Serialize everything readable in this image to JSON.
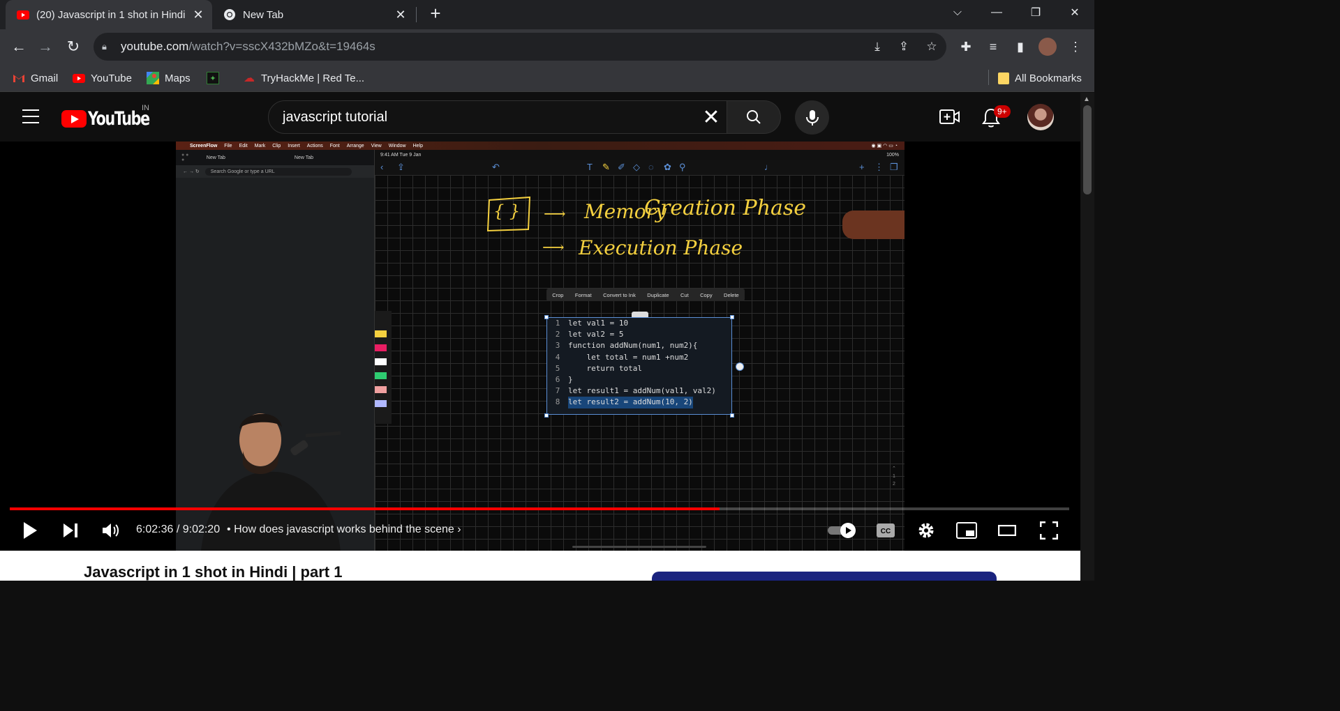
{
  "browser": {
    "tabs": [
      {
        "title": "(20) Javascript in 1 shot in Hindi",
        "active": true,
        "icon": "youtube-icon"
      },
      {
        "title": "New Tab",
        "active": false,
        "icon": "chrome-icon"
      }
    ],
    "url": {
      "host": "youtube.com",
      "path": "/watch?v=sscX432bMZo&t=19464s"
    },
    "bookmarks": [
      {
        "label": "Gmail",
        "icon": "gmail-icon"
      },
      {
        "label": "YouTube",
        "icon": "youtube-icon"
      },
      {
        "label": "Maps",
        "icon": "maps-icon"
      },
      {
        "label": "",
        "icon": "extension-bookmark-icon"
      },
      {
        "label": "TryHackMe | Red Te...",
        "icon": "tryhackme-icon"
      }
    ],
    "all_bookmarks": "All Bookmarks"
  },
  "youtube": {
    "logo_text": "YouTube",
    "country": "IN",
    "search_query": "javascript tutorial",
    "notifications": "9+"
  },
  "video": {
    "time": "6:02:36 / 9:02:20",
    "separator": "•",
    "chapter": "How does javascript works behind the scene",
    "progress_fraction": 0.67,
    "title": "Javascript in 1 shot in Hindi | part 1"
  },
  "frame": {
    "mac_menu": [
      "ScreenFlow",
      "File",
      "Edit",
      "Mark",
      "Clip",
      "Insert",
      "Actions",
      "Font",
      "Arrange",
      "View",
      "Window",
      "Help"
    ],
    "mini_chrome": {
      "tab1": "New Tab",
      "tab2": "New Tab",
      "omnibox": "Search Google or type a URL"
    },
    "ipad_status_left": "9:41 AM  Tue 9 Jan",
    "ipad_status_right": "100%",
    "notes": {
      "braces": "{ }",
      "arrow": "⟶",
      "memory": "Memory",
      "creation": "Creation Phase",
      "execution": "Execution Phase"
    },
    "selection_menu": [
      "Crop",
      "Format",
      "Convert to Ink",
      "Duplicate",
      "Cut",
      "Copy",
      "Delete"
    ],
    "code": [
      {
        "n": "1",
        "text": "let val1 = 10"
      },
      {
        "n": "2",
        "text": "let val2 = 5"
      },
      {
        "n": "3",
        "text": "function addNum(num1, num2){"
      },
      {
        "n": "4",
        "text": "    let total = num1 +num2"
      },
      {
        "n": "5",
        "text": "    return total"
      },
      {
        "n": "6",
        "text": "}"
      },
      {
        "n": "7",
        "text": "let result1 = addNum(val1, val2)"
      },
      {
        "n": "8",
        "text": "let result2 = addNum(10, 2)"
      }
    ],
    "page_indicator": [
      "1",
      "2"
    ]
  }
}
